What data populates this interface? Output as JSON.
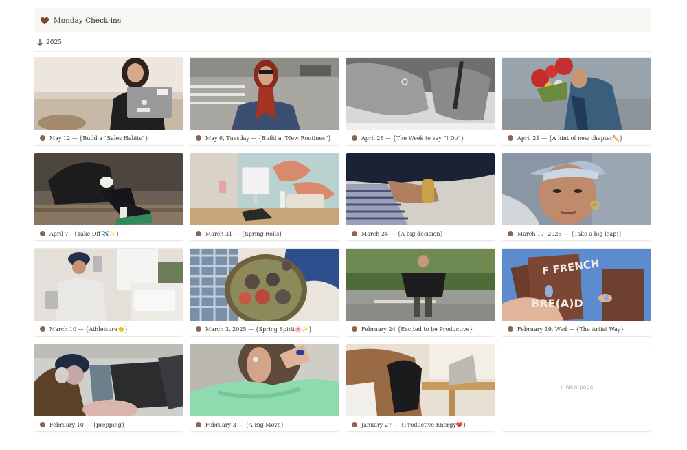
{
  "header": {
    "title": "Monday Check-ins",
    "icon": "brown-heart-icon"
  },
  "group": {
    "label": "2025",
    "icon": "arrow-down-icon"
  },
  "cards": [
    {
      "caption": "May 12 — {Build a “Sales Habits”}"
    },
    {
      "caption": "May 6, Tuesday — {Build a “New Routines”}"
    },
    {
      "caption": "April 28 — {The Week to say “I Do”}"
    },
    {
      "caption": "April 21 — {A hint of new chapter✏️}"
    },
    {
      "caption": "April 7 - {Take Off ✈️✨}"
    },
    {
      "caption": "March 31 — {Spring Rolls}"
    },
    {
      "caption": "March 24 — {A big decision}"
    },
    {
      "caption": "March 17, 2025 — {Take a big leap!}"
    },
    {
      "caption": "March 10 — {Athleisure👏}"
    },
    {
      "caption": "March 3, 2025 — {Spring Spirit🌸✨}"
    },
    {
      "caption": "February 24 {Excited to be Productive}"
    },
    {
      "caption": "February 19, Wed — {The Artist Way}"
    },
    {
      "caption": "February 10 — {prepping}"
    },
    {
      "caption": "February 3 — {A Big Move}"
    },
    {
      "caption": "January 27 — {Productive Energy❤️}"
    }
  ],
  "new_page": {
    "label": "+ New page"
  },
  "colors": {
    "dot": "#8a6650",
    "header_bg": "#f7f6f3"
  }
}
